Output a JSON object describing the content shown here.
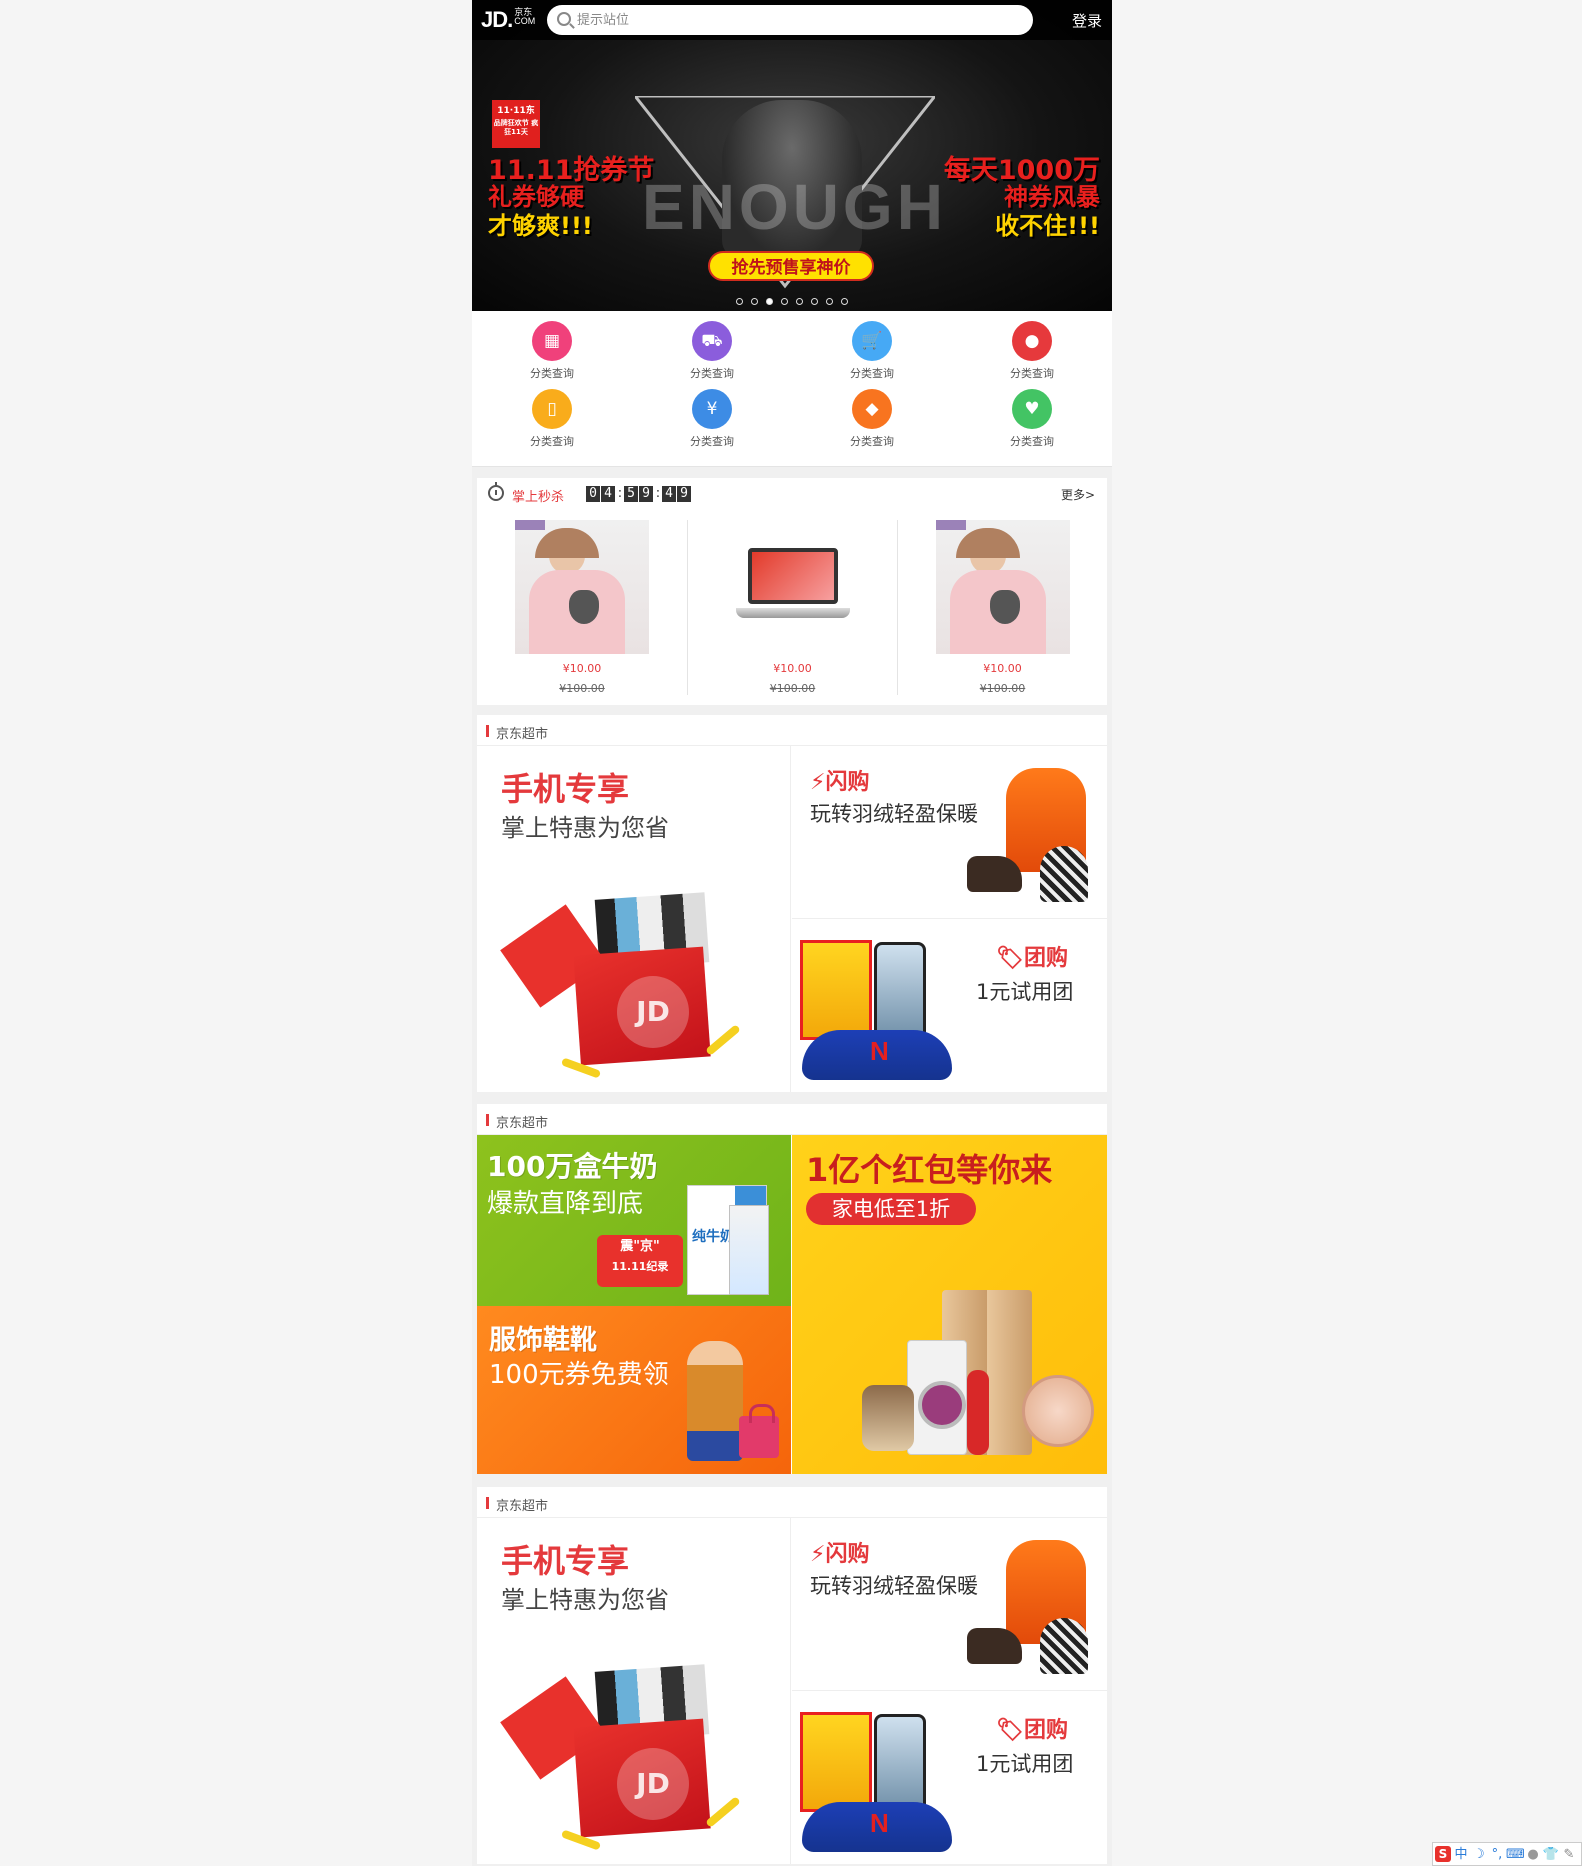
{
  "header": {
    "logo_text": "JD.",
    "logo_cn": "京东",
    "logo_com": "COM",
    "search_placeholder": "提示站位",
    "login_label": "登录"
  },
  "banner": {
    "badge": "11·11东",
    "badge_sub": "品牌狂欢节 疯狂11天",
    "left_line1": "11.11抢券节",
    "left_line2": "礼券够硬",
    "left_line3": "才够爽!!!",
    "right_line1": "每天1000万",
    "right_line2": "神券风暴",
    "right_line3": "收不住!!!",
    "cta": "抢先预售享神价",
    "bg_word": "ENOUGH",
    "active_dot": 3,
    "dot_count": 8
  },
  "nav": {
    "items": [
      {
        "label": "分类查询",
        "icon": "grid-icon",
        "glyph": "▦",
        "color": "#f0417b"
      },
      {
        "label": "分类查询",
        "icon": "truck-icon",
        "glyph": "⛟",
        "color": "#8b5ddc"
      },
      {
        "label": "分类查询",
        "icon": "cart-icon",
        "glyph": "🛒",
        "color": "#46a9f5"
      },
      {
        "label": "分类查询",
        "icon": "user-icon",
        "glyph": "●",
        "color": "#e6393c"
      },
      {
        "label": "分类查询",
        "icon": "phone-recharge-icon",
        "glyph": "▯",
        "color": "#f9ac1b"
      },
      {
        "label": "分类查询",
        "icon": "coupon-icon",
        "glyph": "¥",
        "color": "#3d8ce5"
      },
      {
        "label": "分类查询",
        "icon": "ticket-icon",
        "glyph": "◆",
        "color": "#f8741f"
      },
      {
        "label": "分类查询",
        "icon": "heart-icon",
        "glyph": "♥",
        "color": "#43c464"
      }
    ]
  },
  "seckill": {
    "title": "掌上秒杀",
    "countdown": [
      "0",
      "4",
      ":",
      "5",
      "9",
      ":",
      "4",
      "9"
    ],
    "more_label": "更多>",
    "items": [
      {
        "price": "¥10.00",
        "old_price": "¥100.00",
        "image": "pajamas"
      },
      {
        "price": "¥10.00",
        "old_price": "¥100.00",
        "image": "laptop"
      },
      {
        "price": "¥10.00",
        "old_price": "¥100.00",
        "image": "pajamas"
      }
    ]
  },
  "sections": [
    {
      "title": "京东超市",
      "big_title": "手机专享",
      "big_sub": "掌上特惠为您省",
      "big_badge": "JD",
      "top_tag": "闪购",
      "top_sub": "玩转羽绒轻盈保暖",
      "bottom_tag": "团购",
      "bottom_sub": "1元试用团"
    },
    {
      "title": "京东超市",
      "green_h": "100万盒牛奶",
      "green_s": "爆款直降到底",
      "green_badge": "震\"京\"",
      "green_badge2": "11.11纪录",
      "milk_label": "纯牛奶",
      "orange_h": "服饰鞋靴",
      "orange_s": "100元券免费领",
      "yellow_h": "1亿个红包等你来",
      "yellow_pill": "家电低至1折"
    },
    {
      "title": "京东超市",
      "big_title": "手机专享",
      "big_sub": "掌上特惠为您省",
      "big_badge": "JD",
      "top_tag": "闪购",
      "top_sub": "玩转羽绒轻盈保暖",
      "bottom_tag": "团购",
      "bottom_sub": "1元试用团"
    }
  ],
  "ime": {
    "logo": "S",
    "mode": "中"
  }
}
